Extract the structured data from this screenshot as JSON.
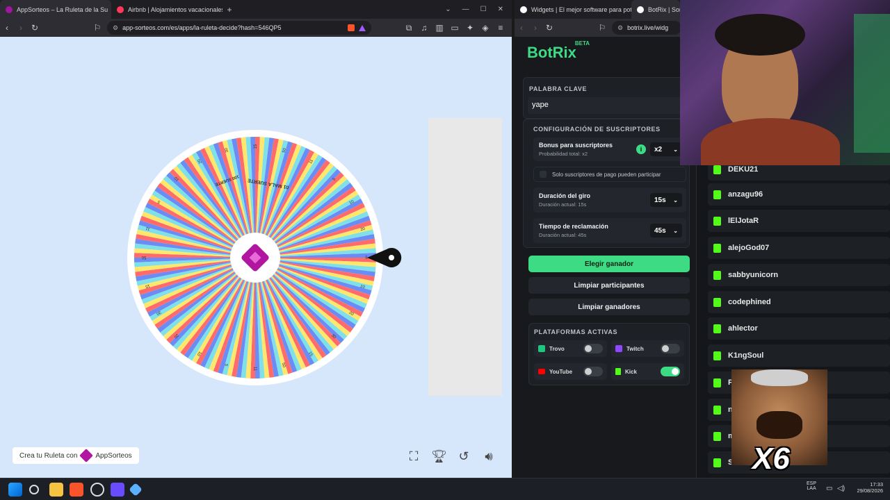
{
  "left_browser": {
    "tabs": [
      {
        "title": "AppSorteos – La Ruleta de la Su",
        "active": true
      },
      {
        "title": "Airbnb | Alojamientos vacacionales y",
        "active": false
      }
    ],
    "new_tab": "+",
    "url": "app-sorteos.com/es/apps/la-ruleta-decide?hash=546QP5",
    "wheel_labels": [
      "01 MALA SUERTE",
      "100 SUERTE",
      "5",
      "10",
      "20",
      "30",
      "15",
      "50",
      "11"
    ],
    "crea_text": "Crea tu Ruleta con",
    "brand_text": "AppSorteos"
  },
  "right_browser": {
    "tabs": [
      {
        "title": "Widgets | El mejor software para pot",
        "active": false
      },
      {
        "title": "BotRix | Sort",
        "active": true
      }
    ],
    "url": "botrix.live/widg",
    "brand": {
      "name": "BotRix",
      "badge": "BETA"
    },
    "keyword": {
      "title": "PALABRA CLAVE",
      "value": "yape"
    },
    "subs_config": {
      "title": "CONFIGURACIÓN DE SUSCRIPTORES",
      "bonus_label": "Bonus para suscriptores",
      "bonus_sub": "Probabilidad total: x2",
      "bonus_value": "x2",
      "only_paid": "Solo suscriptores de pago pueden participar",
      "spin_label": "Duración del giro",
      "spin_sub": "Duración actual: 15s",
      "spin_value": "15s",
      "claim_label": "Tiempo de reclamación",
      "claim_sub": "Duración actual: 45s",
      "claim_value": "45s"
    },
    "buttons": {
      "choose": "Elegir ganador",
      "clear_participants": "Limpiar participantes",
      "clear_winners": "Limpiar ganadores"
    },
    "platforms": {
      "title": "PLATAFORMAS ACTIVAS",
      "items": [
        {
          "name": "Trovo",
          "on": false,
          "color": "#1ec77f"
        },
        {
          "name": "Twitch",
          "on": false,
          "color": "#9146ff"
        },
        {
          "name": "YouTube",
          "on": false,
          "color": "#ff0000"
        },
        {
          "name": "Kick",
          "on": true,
          "color": "#53fc18"
        }
      ]
    },
    "participants": [
      "DEKU21",
      "anzagu96",
      "lElJotaR",
      "alejoGod07",
      "sabbyunicorn",
      "codephined",
      "ahlector",
      "K1ngSoul",
      "P",
      "n",
      "m",
      "S"
    ]
  },
  "overlay": {
    "multiplier": "X6"
  },
  "taskbar": {
    "lang_top": "ESP",
    "lang_bottom": "LAA",
    "time": "17:33",
    "date": "29/08/2026"
  }
}
